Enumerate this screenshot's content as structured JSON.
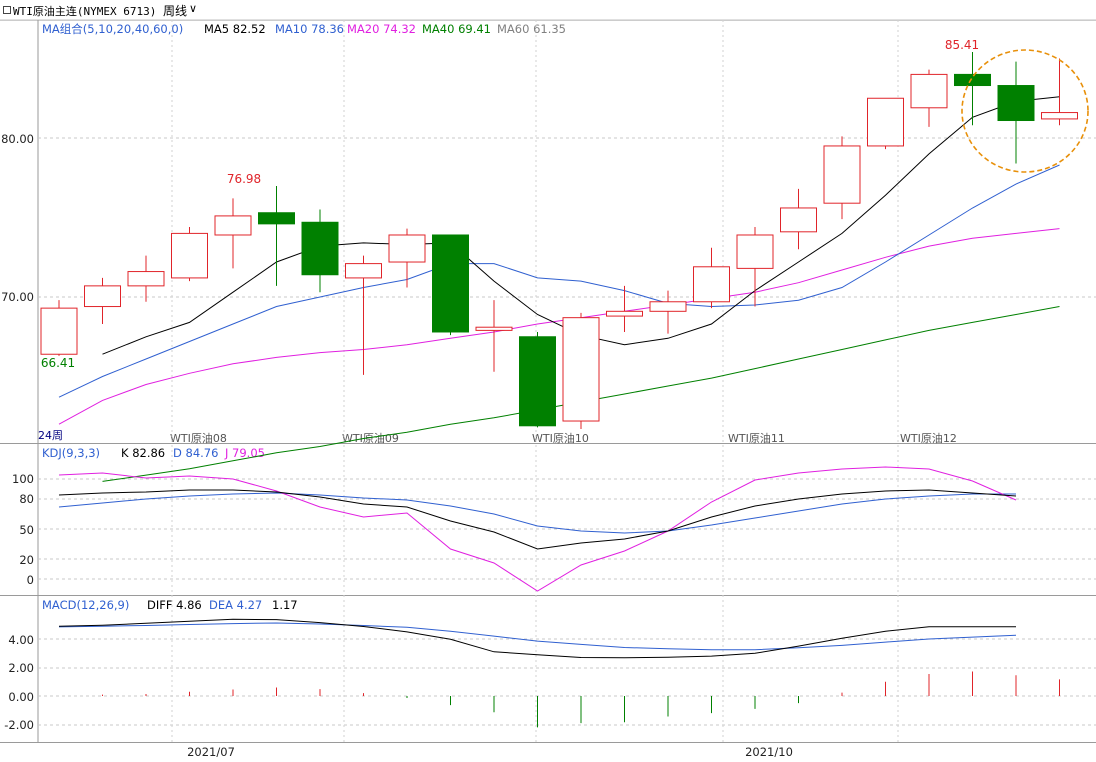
{
  "header": {
    "title": "WTI原油主连(NYMEX 6713)",
    "period": "周线",
    "period_chevron": "∨"
  },
  "colors": {
    "up": "#e0242a",
    "down": "#008000",
    "ma5": "#000000",
    "ma10": "#3060d0",
    "ma20": "#e020e0",
    "ma40": "#008000",
    "ma60": "#808080",
    "grid": "#c8c8c8",
    "highlight": "#e8900a"
  },
  "main_panel": {
    "legend": {
      "name": "MA组合(5,10,20,40,60,0)",
      "items": [
        {
          "label": "MA5 82.52",
          "color": "#000000"
        },
        {
          "label": "MA10 78.36",
          "color": "#3060d0"
        },
        {
          "label": "MA20 74.32",
          "color": "#e020e0"
        },
        {
          "label": "MA40 69.41",
          "color": "#008000"
        },
        {
          "label": "MA60 61.35",
          "color": "#808080"
        }
      ]
    },
    "y_ticks": [
      "80.00",
      "70.00"
    ],
    "annotations": {
      "high_1": "76.98",
      "high_2": "85.41",
      "low_1": "66.41"
    },
    "x_markers": [
      "24周",
      "WTI原油08",
      "WTI原油09",
      "WTI原油10",
      "WTI原油11",
      "WTI原油12"
    ]
  },
  "kdj_panel": {
    "name": "KDJ(9,3,3)",
    "values": [
      {
        "label": "K 82.86",
        "color": "#000000"
      },
      {
        "label": "D 84.76",
        "color": "#3060d0"
      },
      {
        "label": "J 79.05",
        "color": "#e020e0"
      }
    ],
    "y_ticks": [
      "100",
      "80",
      "50",
      "20",
      "0"
    ]
  },
  "macd_panel": {
    "name": "MACD(12,26,9)",
    "values": [
      {
        "label": "DIFF 4.86",
        "color": "#000000"
      },
      {
        "label": "DEA 4.27",
        "color": "#3060d0"
      },
      {
        "label": "1.17",
        "color": "#000000"
      }
    ],
    "y_ticks": [
      "4.00",
      "2.00",
      "0.00",
      "-2.00"
    ]
  },
  "x_axis": {
    "labels": [
      "2021/07",
      "2021/10"
    ]
  },
  "chart_data": {
    "type": "candlestick",
    "title": "WTI原油主连(NYMEX 6713) 周线",
    "ylim": [
      61.5,
      87.5
    ],
    "candles": [
      {
        "o": 66.4,
        "h": 69.8,
        "l": 66.3,
        "c": 69.3
      },
      {
        "o": 69.4,
        "h": 71.2,
        "l": 68.3,
        "c": 70.7
      },
      {
        "o": 70.7,
        "h": 72.6,
        "l": 69.7,
        "c": 71.6
      },
      {
        "o": 71.2,
        "h": 74.4,
        "l": 71.0,
        "c": 74.0
      },
      {
        "o": 73.9,
        "h": 76.2,
        "l": 71.8,
        "c": 75.1
      },
      {
        "o": 75.3,
        "h": 76.98,
        "l": 70.7,
        "c": 74.6
      },
      {
        "o": 74.7,
        "h": 75.5,
        "l": 70.3,
        "c": 71.4
      },
      {
        "o": 71.2,
        "h": 72.6,
        "l": 65.1,
        "c": 72.1
      },
      {
        "o": 72.2,
        "h": 74.3,
        "l": 70.6,
        "c": 73.9
      },
      {
        "o": 73.9,
        "h": 73.9,
        "l": 67.6,
        "c": 67.8
      },
      {
        "o": 67.9,
        "h": 69.8,
        "l": 65.3,
        "c": 68.1
      },
      {
        "o": 67.5,
        "h": 67.8,
        "l": 61.8,
        "c": 61.9
      },
      {
        "o": 62.2,
        "h": 69.0,
        "l": 61.7,
        "c": 68.7
      },
      {
        "o": 68.8,
        "h": 70.7,
        "l": 67.8,
        "c": 69.1
      },
      {
        "o": 69.1,
        "h": 70.4,
        "l": 67.7,
        "c": 69.7
      },
      {
        "o": 69.7,
        "h": 73.1,
        "l": 69.3,
        "c": 71.9
      },
      {
        "o": 71.8,
        "h": 74.4,
        "l": 69.4,
        "c": 73.9
      },
      {
        "o": 74.1,
        "h": 76.8,
        "l": 73.0,
        "c": 75.6
      },
      {
        "o": 75.9,
        "h": 80.1,
        "l": 74.9,
        "c": 79.5
      },
      {
        "o": 79.5,
        "h": 82.5,
        "l": 79.3,
        "c": 82.5
      },
      {
        "o": 81.9,
        "h": 84.3,
        "l": 80.7,
        "c": 84.0
      },
      {
        "o": 84.0,
        "h": 85.41,
        "l": 80.8,
        "c": 83.3
      },
      {
        "o": 83.3,
        "h": 84.8,
        "l": 78.4,
        "c": 81.1
      },
      {
        "o": 81.2,
        "h": 85.0,
        "l": 80.8,
        "c": 81.6
      }
    ],
    "ma5": [
      66.4,
      67.5,
      68.4,
      70.3,
      72.2,
      73.2,
      73.4,
      73.3,
      73.4,
      71.0,
      68.9,
      67.6,
      67.0,
      67.4,
      68.3,
      70.4,
      72.2,
      74.0,
      76.4,
      79.0,
      81.3,
      82.3,
      82.6
    ],
    "ma10": [
      63.7,
      65.0,
      66.1,
      67.2,
      68.3,
      69.4,
      70.0,
      70.6,
      71.1,
      72.1,
      72.1,
      71.2,
      71.0,
      70.4,
      69.6,
      69.4,
      69.5,
      69.8,
      70.6,
      72.2,
      73.9,
      75.6,
      77.1,
      78.3
    ],
    "ma20": [
      62.0,
      63.5,
      64.5,
      65.2,
      65.8,
      66.2,
      66.5,
      66.7,
      67.0,
      67.4,
      67.8,
      68.3,
      68.7,
      69.1,
      69.5,
      69.9,
      70.3,
      70.9,
      71.7,
      72.5,
      73.2,
      73.7,
      74.0,
      74.3
    ],
    "ma40": [
      58.4,
      58.8,
      59.2,
      59.7,
      60.2,
      60.6,
      61.1,
      61.5,
      62.0,
      62.4,
      62.9,
      63.4,
      63.9,
      64.4,
      64.9,
      65.5,
      66.1,
      66.7,
      67.3,
      67.9,
      68.4,
      68.9,
      69.4
    ],
    "kdj": {
      "K": [
        84,
        86,
        87,
        89,
        89,
        87,
        82,
        75,
        72,
        58,
        47,
        30,
        36,
        40,
        48,
        62,
        73,
        80,
        85,
        88,
        89,
        86,
        83
      ],
      "D": [
        72,
        76,
        80,
        83,
        85,
        86,
        84,
        81,
        79,
        73,
        65,
        53,
        48,
        46,
        48,
        54,
        61,
        68,
        75,
        80,
        83,
        85,
        85
      ],
      "J": [
        104,
        106,
        101,
        103,
        100,
        88,
        72,
        62,
        66,
        30,
        16,
        -12,
        14,
        28,
        48,
        77,
        99,
        106,
        110,
        112,
        110,
        98,
        79
      ]
    },
    "macd": {
      "DIFF": [
        4.9,
        4.97,
        5.1,
        5.25,
        5.38,
        5.36,
        5.15,
        4.88,
        4.5,
        3.98,
        3.1,
        2.9,
        2.7,
        2.68,
        2.72,
        2.8,
        3.0,
        3.5,
        4.05,
        4.55,
        4.86,
        4.86,
        4.86
      ],
      "DEA": [
        4.85,
        4.9,
        4.95,
        5.02,
        5.08,
        5.12,
        5.05,
        4.95,
        4.82,
        4.55,
        4.2,
        3.85,
        3.62,
        3.4,
        3.32,
        3.25,
        3.25,
        3.38,
        3.55,
        3.78,
        4.0,
        4.13,
        4.27
      ],
      "HIST": [
        0.1,
        0.14,
        0.3,
        0.46,
        0.6,
        0.48,
        0.2,
        -0.14,
        -0.64,
        -1.14,
        -2.2,
        -1.9,
        -1.84,
        -1.44,
        -1.2,
        -0.9,
        -0.5,
        0.24,
        1.0,
        1.54,
        1.72,
        1.46,
        1.17
      ]
    }
  }
}
